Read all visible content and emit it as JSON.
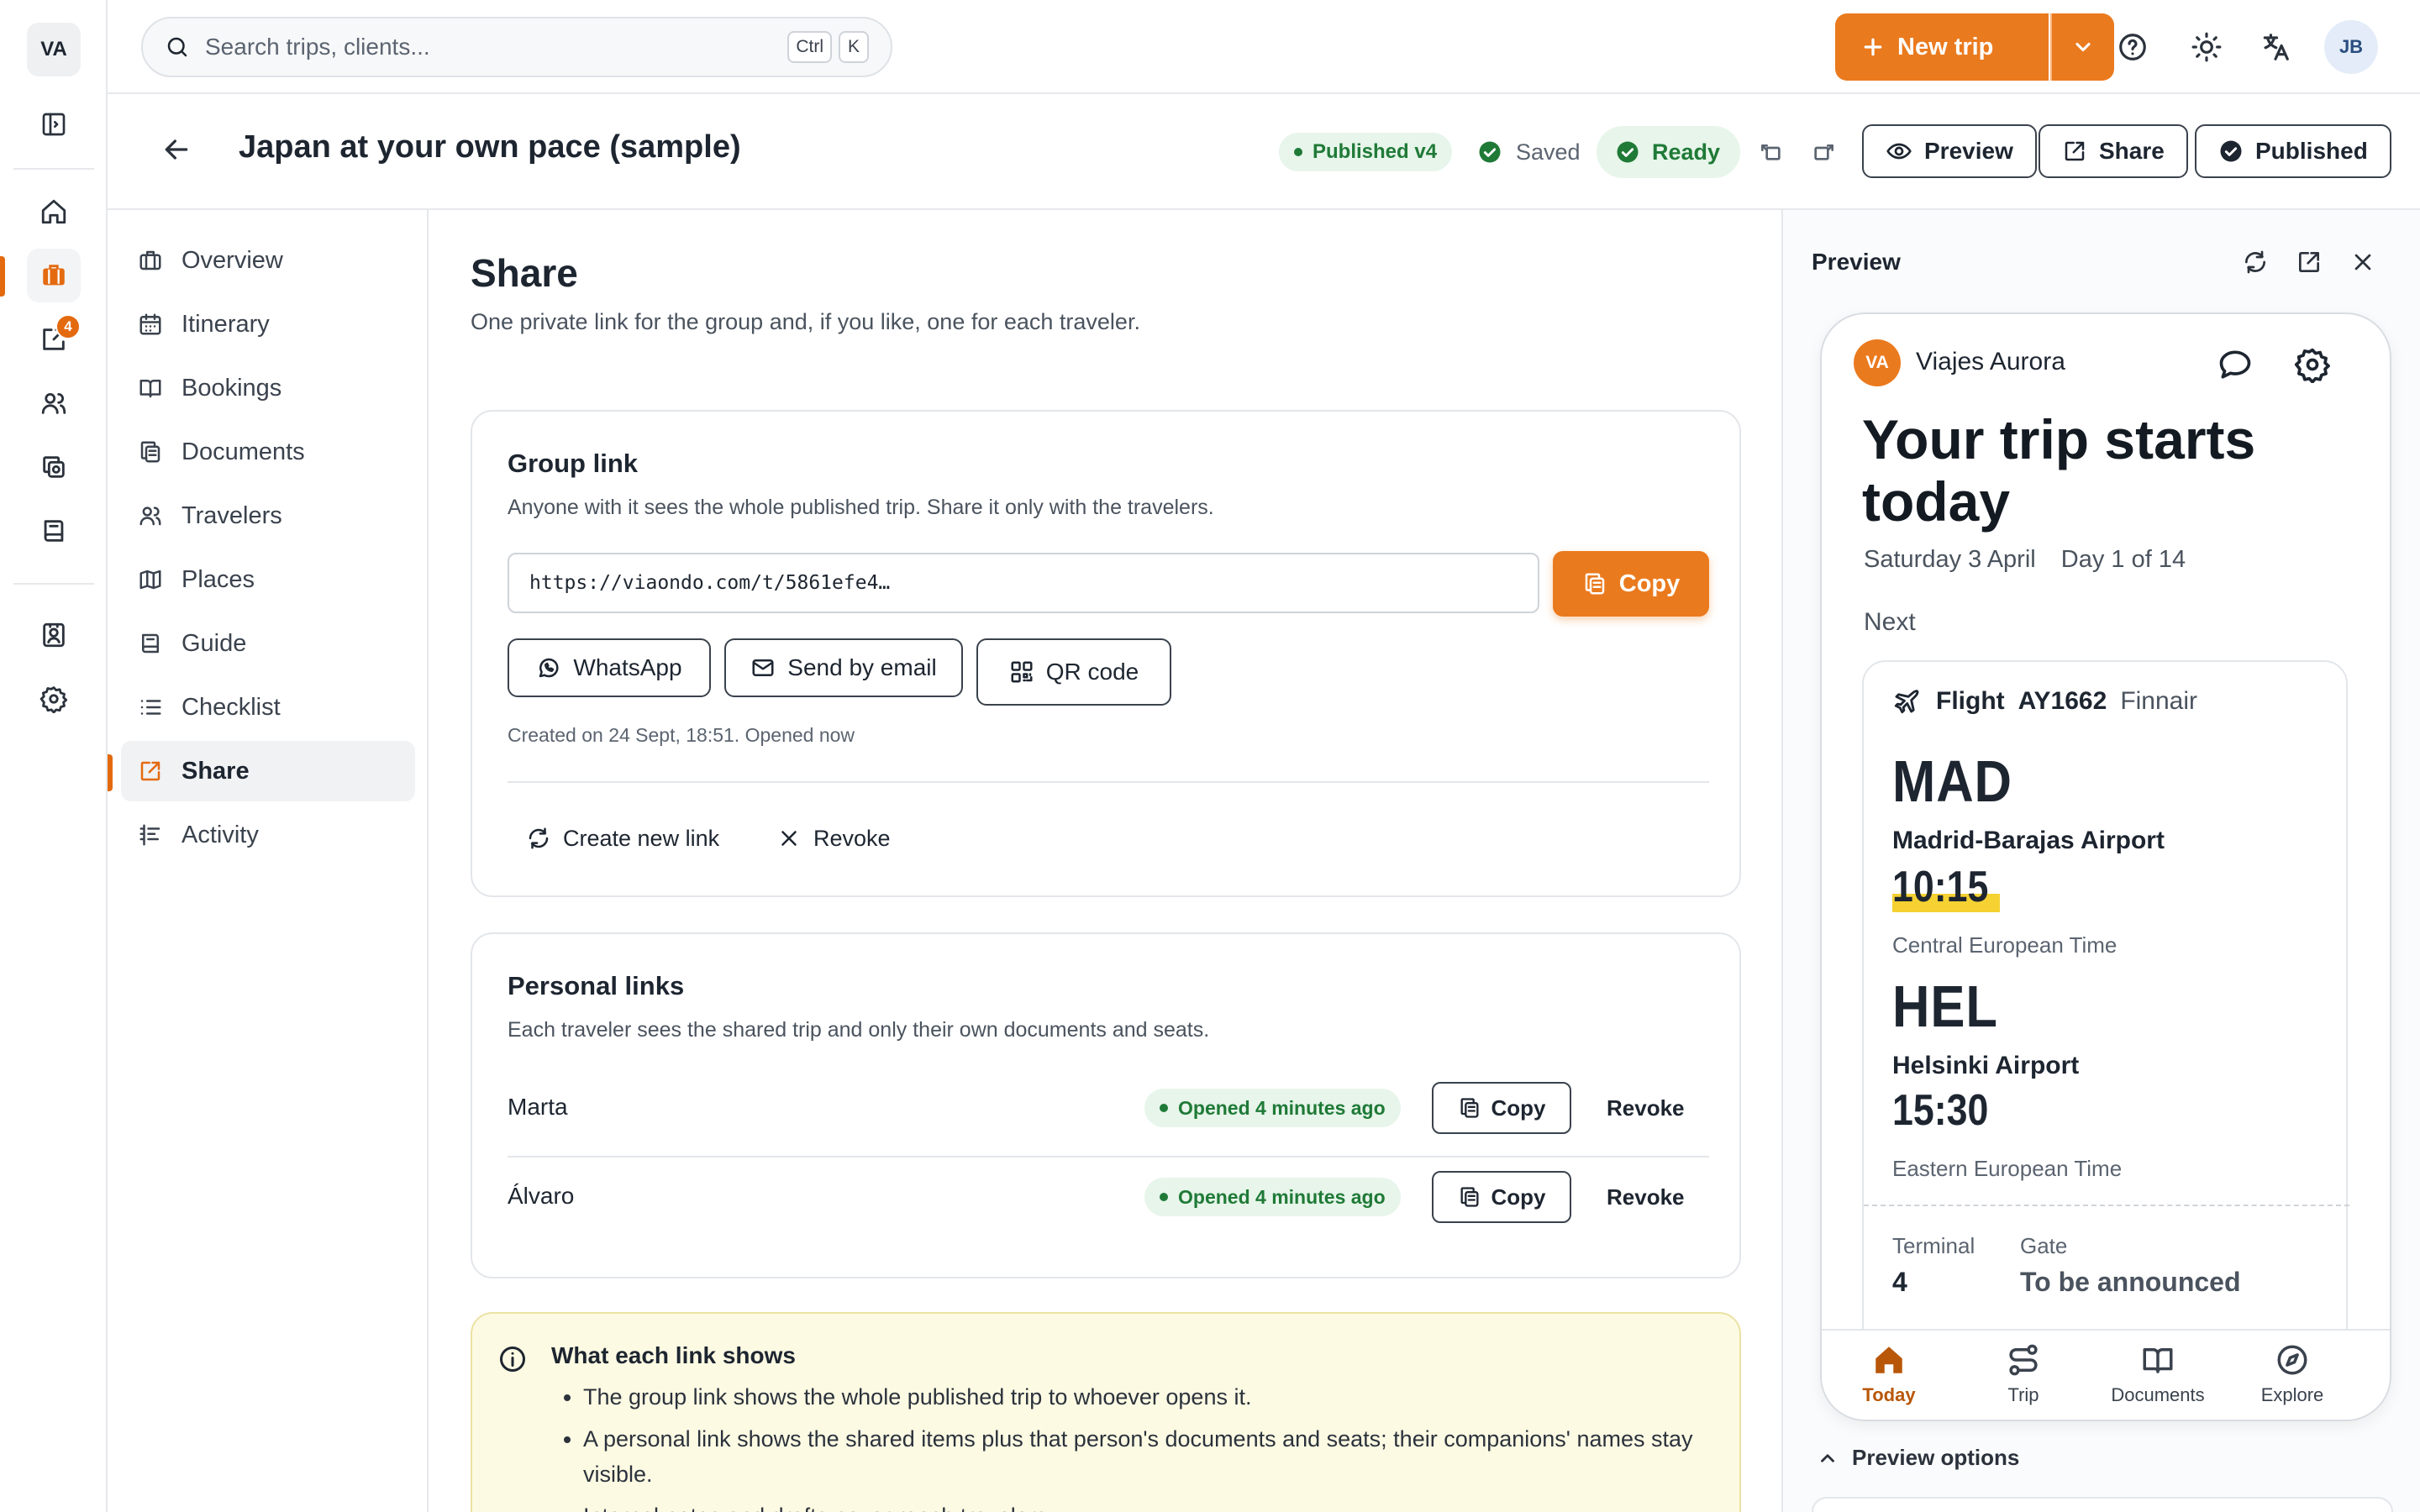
{
  "rail": {
    "workspace_avatar": "VA",
    "notification_count": "4",
    "active_color": "#e46a10"
  },
  "topbar": {
    "search_placeholder": "Search trips, clients...",
    "shortcut_ctrl": "Ctrl",
    "shortcut_key": "K",
    "new_trip_label": "New trip",
    "user_initials": "JB",
    "accent": "#ea7a1e"
  },
  "trip": {
    "title": "Japan at your own pace (sample)",
    "published_badge": "Published v4",
    "saved_label": "Saved",
    "ready_label": "Ready",
    "preview_label": "Preview",
    "share_label": "Share",
    "published_label": "Published"
  },
  "nav": {
    "items": [
      {
        "label": "Overview",
        "icon": "briefcase-icon"
      },
      {
        "label": "Itinerary",
        "icon": "calendar-icon"
      },
      {
        "label": "Bookings",
        "icon": "book-open-icon"
      },
      {
        "label": "Documents",
        "icon": "copy-icon"
      },
      {
        "label": "Travelers",
        "icon": "users-icon"
      },
      {
        "label": "Places",
        "icon": "map-icon"
      },
      {
        "label": "Guide",
        "icon": "book-icon"
      },
      {
        "label": "Checklist",
        "icon": "list-icon"
      },
      {
        "label": "Share",
        "icon": "share-icon"
      },
      {
        "label": "Activity",
        "icon": "activity-icon"
      }
    ],
    "active_index": 8
  },
  "share": {
    "title": "Share",
    "subtitle": "One private link for the group and, if you like, one for each traveler.",
    "group": {
      "title": "Group link",
      "description": "Anyone with it sees the whole published trip. Share it only with the travelers.",
      "url": "https://viaondo.com/t/5861efe4…",
      "copy_label": "Copy",
      "whatsapp_label": "WhatsApp",
      "email_label": "Send by email",
      "qr_label": "QR code",
      "created": "Created on 24 Sept, 18:51. Opened now",
      "new_link_label": "Create new link",
      "revoke_label": "Revoke"
    },
    "personal": {
      "title": "Personal links",
      "description": "Each traveler sees the shared trip and only their own documents and seats.",
      "rows": [
        {
          "name": "Marta",
          "status": "Opened 4 minutes ago",
          "copy": "Copy",
          "revoke": "Revoke"
        },
        {
          "name": "Álvaro",
          "status": "Opened 4 minutes ago",
          "copy": "Copy",
          "revoke": "Revoke"
        }
      ]
    },
    "note": {
      "title": "What each link shows",
      "items": [
        "The group link shows the whole published trip to whoever opens it.",
        "A personal link shows the shared items plus that person's documents and seats; their companions' names stay visible.",
        "Internal notes and drafts never reach travelers."
      ]
    }
  },
  "preview": {
    "title": "Preview",
    "agency_initials": "VA",
    "agency_name": "Viajes Aurora",
    "headline": "Your trip starts today",
    "date": "Saturday 3 April",
    "day": "Day 1 of 14",
    "next_label": "Next",
    "flight": {
      "type": "Flight",
      "number": "AY1662",
      "airline": "Finnair",
      "from_code": "MAD",
      "from_airport": "Madrid-Barajas Airport",
      "from_time": "10:15",
      "from_tz": "Central European Time",
      "to_code": "HEL",
      "to_airport": "Helsinki Airport",
      "to_time": "15:30",
      "to_tz": "Eastern European Time",
      "terminal_label": "Terminal",
      "terminal": "4",
      "gate_label": "Gate",
      "gate": "To be announced",
      "highlight_color": "#f5d132"
    },
    "tabs": [
      {
        "label": "Today",
        "icon": "home-icon"
      },
      {
        "label": "Trip",
        "icon": "route-icon"
      },
      {
        "label": "Documents",
        "icon": "book-open-icon"
      },
      {
        "label": "Explore",
        "icon": "compass-icon"
      }
    ],
    "options_label": "Preview options"
  }
}
